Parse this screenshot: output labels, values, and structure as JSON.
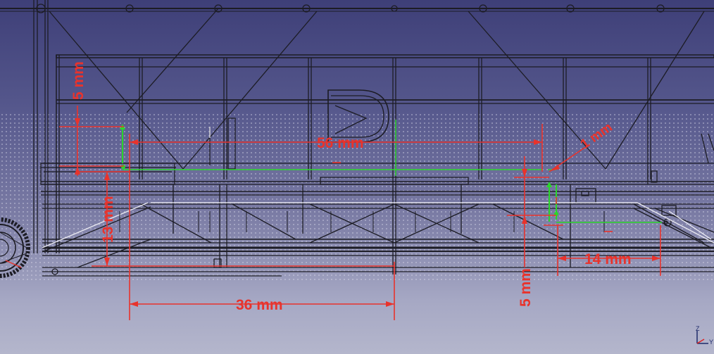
{
  "app": {
    "name": "FreeCAD 3D view"
  },
  "colors": {
    "background_top": "#3e3f78",
    "background_bottom": "#b4b6cc",
    "geometry": "#1c1c24",
    "dimension": "#e8332c",
    "constraint": "#2bd62b",
    "axis_x": "#d22",
    "axis_y": "#1e2a6a",
    "axis_z": "#1e2a6a"
  },
  "dimensions": [
    {
      "id": "dim-56",
      "label": "56 mm"
    },
    {
      "id": "dim-36",
      "label": "36 mm"
    },
    {
      "id": "dim-14",
      "label": "14 mm"
    },
    {
      "id": "dim-13",
      "label": "13 mm"
    },
    {
      "id": "dim-5-top",
      "label": "5 mm"
    },
    {
      "id": "dim-5-right",
      "label": "5 mm"
    },
    {
      "id": "dim-1",
      "label": "1 mm"
    }
  ],
  "axis_triad": {
    "z": "Z",
    "y": "Y"
  }
}
